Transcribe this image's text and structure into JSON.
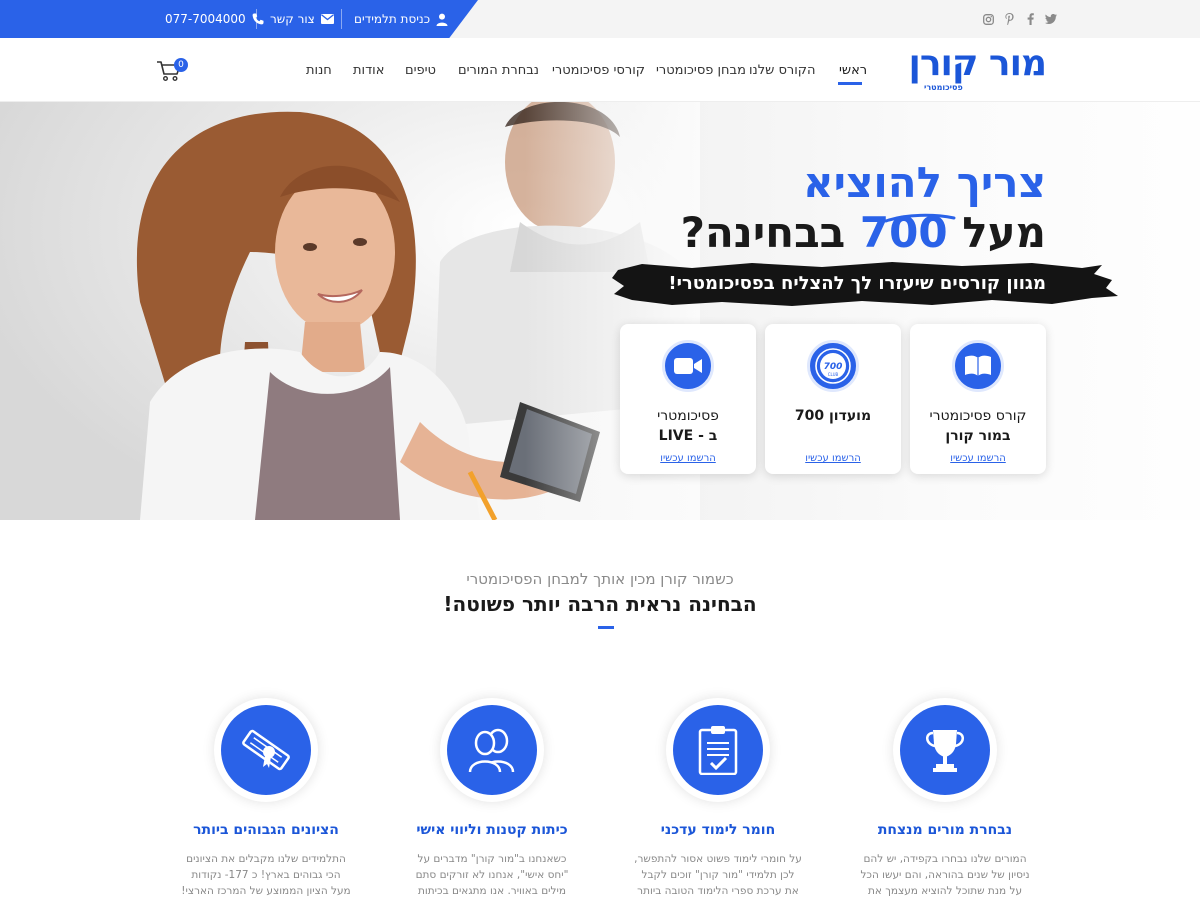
{
  "topbar": {
    "student_login": "כניסת תלמידים",
    "contact": "צור קשר",
    "phone": "077-7004000",
    "social_icons": [
      "twitter-icon",
      "facebook-icon",
      "pinterest-icon",
      "instagram-icon"
    ]
  },
  "header": {
    "logo_main": "מור קורן",
    "logo_sub": "פסיכומטרי",
    "nav": [
      {
        "label": "ראשי",
        "active": true
      },
      {
        "label": "הקורס שלנו"
      },
      {
        "label": "מבחן פסיכומטרי"
      },
      {
        "label": "קורסי פסיכומטרי"
      },
      {
        "label": "נבחרת המורים"
      },
      {
        "label": "טיפים"
      },
      {
        "label": "אודות"
      },
      {
        "label": "חנות"
      }
    ],
    "cart_count": "0"
  },
  "hero": {
    "line1": "צריך להוציא",
    "line2_prefix": "מעל",
    "line2_number": "700",
    "line2_suffix": "בבחינה?",
    "banner": "מגוון קורסים שיעזרו לך להצליח בפסיכומטרי!",
    "cards": [
      {
        "title_line1": "קורס פסיכומטרי",
        "title_line2": "במור קורן",
        "link": "הרשמו עכשיו",
        "icon": "book-icon"
      },
      {
        "title_line1": "מועדון 700",
        "title_line2": "",
        "link": "הרשמו עכשיו",
        "icon": "700-club-badge-icon"
      },
      {
        "title_line1": "פסיכומטרי",
        "title_line2": "ב - LIVE",
        "link": "הרשמו עכשיו",
        "icon": "video-camera-icon"
      }
    ]
  },
  "intro": {
    "subtitle": "כשמור קורן מכין אותך למבחן הפסיכומטרי",
    "title": "הבחינה נראית הרבה יותר פשוטה!"
  },
  "features": [
    {
      "title": "נבחרת מורים מנצחת",
      "text": "המורים שלנו נבחרו בקפידה, יש להם ניסיון של שנים בהוראה, והם יעשו הכל על מנת שתוכל להוציא מעצמך את",
      "icon": "trophy-icon"
    },
    {
      "title": "חומר לימוד עדכני",
      "text": "על חומרי לימוד פשוט אסור להתפשר, לכן תלמידי \"מור קורן\" זוכים לקבל את ערכת ספרי הלימוד הטובה ביותר בשוק",
      "icon": "clipboard-check-icon"
    },
    {
      "title": "כיתות קטנות וליווי אישי",
      "text": "כשאנחנו ב\"מור קורן\" מדברים על \"יחס אישי\", אנחנו לא זורקים סתם מילים באוויר. אנו מתגאים בכיתות",
      "icon": "users-icon"
    },
    {
      "title": "הציונים הגבוהים ביותר",
      "text": "התלמידים שלנו מקבלים את הציונים הכי גבוהים בארץ! כ 177- נקודות מעל הציון הממוצע של המרכז הארצי!",
      "icon": "diploma-icon"
    }
  ],
  "colors": {
    "brand_blue": "#2a62e8",
    "logo_blue": "#1b56d8"
  }
}
